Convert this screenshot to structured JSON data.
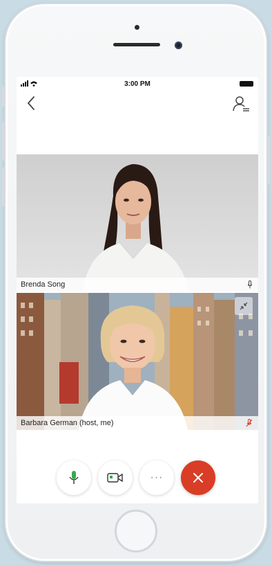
{
  "status_bar": {
    "time": "3:00 PM"
  },
  "participants": [
    {
      "name": "Brenda Song"
    },
    {
      "name": "Barbara German (host, me)"
    }
  ],
  "controls": {
    "more_label": "···"
  },
  "icons": {
    "back": "chevron-left-icon",
    "participants": "participants-icon",
    "mic": "microphone-icon",
    "video": "video-camera-icon",
    "more": "more-icon",
    "end": "end-call-icon"
  },
  "colors": {
    "end_call": "#d93d25",
    "mic_active": "#3aa84f",
    "muted": "#d93d25"
  }
}
